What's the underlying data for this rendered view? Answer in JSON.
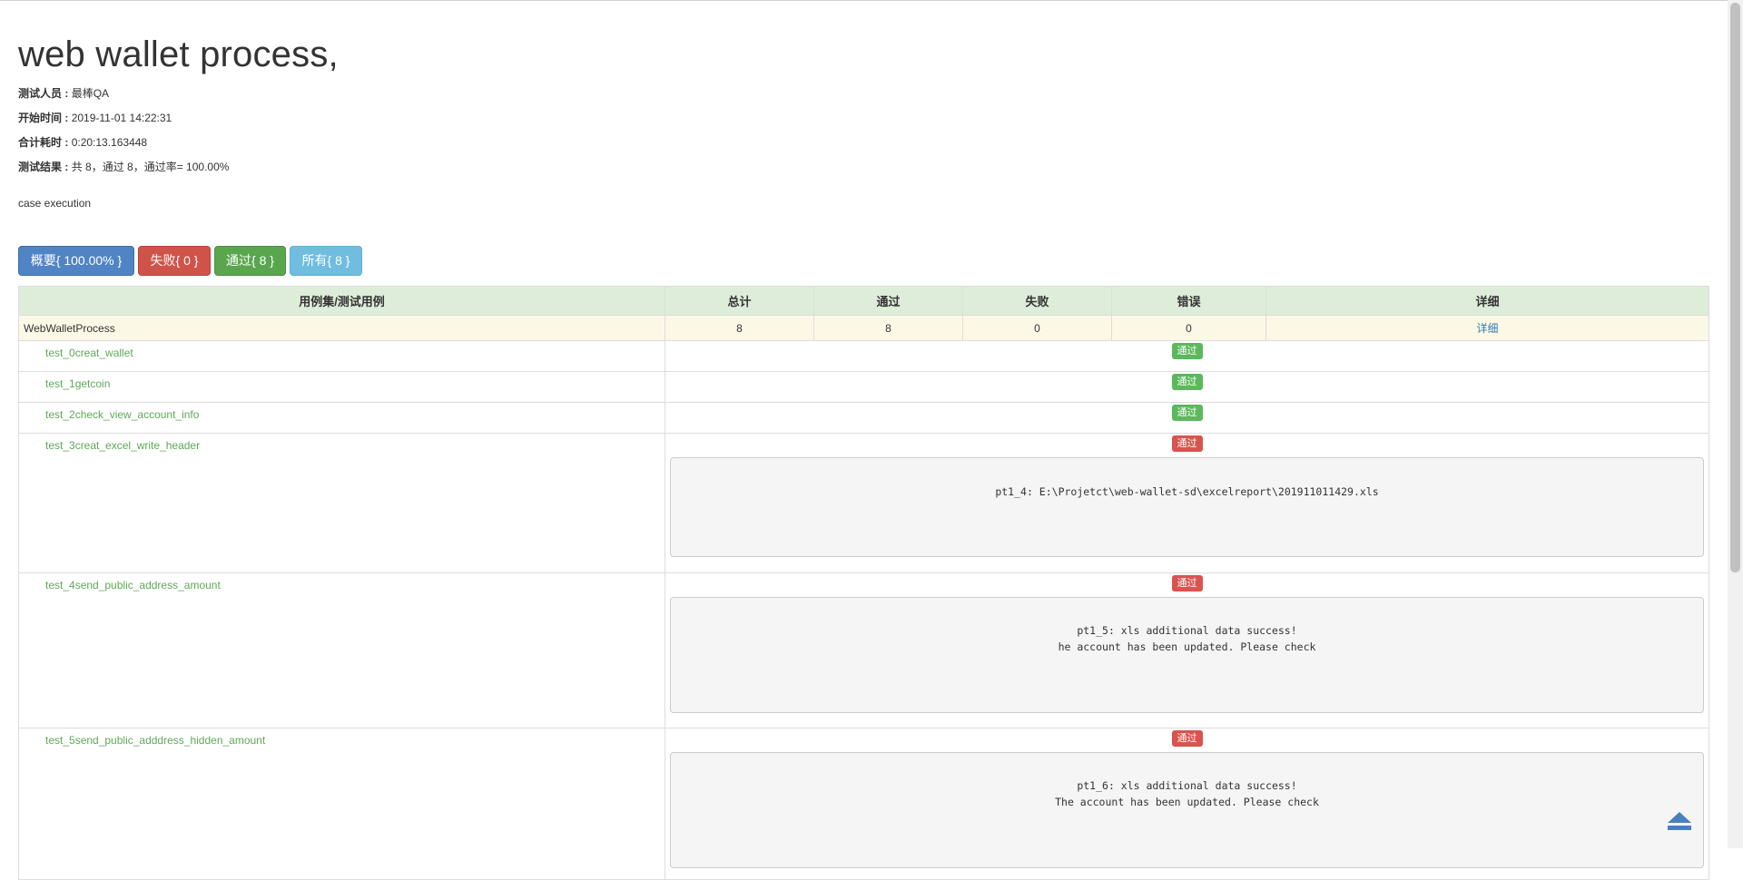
{
  "report": {
    "title": "web wallet process,",
    "tester_label": "测试人员 :",
    "tester": "最棒QA",
    "start_label": "开始时间 :",
    "start_time": "2019-11-01 14:22:31",
    "duration_label": "合计耗时 :",
    "duration": "0:20:13.163448",
    "result_label": "测试结果 :",
    "result": "共 8，通过 8，通过率= 100.00%",
    "description": "case execution"
  },
  "filters": {
    "summary": "概要{ 100.00% }",
    "fail": "失败{ 0 }",
    "pass": "通过{ 8 }",
    "all": "所有{ 8 }"
  },
  "table": {
    "headers": [
      "用例集/测试用例",
      "总计",
      "通过",
      "失败",
      "错误",
      "详细"
    ],
    "suite": {
      "name": "WebWalletProcess",
      "total": "8",
      "pass": "8",
      "fail": "0",
      "error": "0",
      "detail": "详细"
    },
    "cases": [
      {
        "name": "test_0creat_wallet",
        "status": "通过"
      },
      {
        "name": "test_1getcoin",
        "status": "通过"
      },
      {
        "name": "test_2check_view_account_info",
        "status": "通过"
      },
      {
        "name": "test_3creat_excel_write_header",
        "status": "通过",
        "log": "pt1_4: E:\\Projetct\\web-wallet-sd\\excelreport\\201911011429.xls"
      },
      {
        "name": "test_4send_public_address_amount",
        "status": "通过",
        "log": "pt1_5: xls additional data success!\nhe account has been updated. Please check"
      },
      {
        "name": "test_5send_public_adddress_hidden_amount",
        "status": "通过",
        "log": "pt1_6: xls additional data success!\nThe account has been updated. Please check"
      }
    ]
  },
  "colors": {
    "pass_green": "#5cb85c",
    "fail_red": "#d9534f",
    "case_text": "#5fa858"
  },
  "icons": {
    "back_to_top": "eject-up-icon"
  }
}
